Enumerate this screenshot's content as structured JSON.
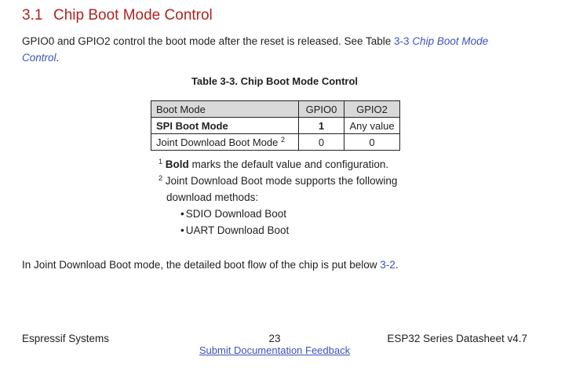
{
  "section": {
    "number": "3.1",
    "title": "Chip Boot Mode Control"
  },
  "intro": {
    "text": "GPIO0 and GPIO2 control the boot mode after the reset is released. See Table ",
    "table_ref": "3-3",
    "table_title_ref": "Chip Boot Mode Control",
    "end": "."
  },
  "table": {
    "caption": "Table 3-3. Chip Boot Mode Control",
    "headers": [
      "Boot Mode",
      "GPIO0",
      "GPIO2"
    ],
    "rows": [
      {
        "mode": "SPI Boot Mode",
        "gpio0": "1",
        "gpio2": "Any value"
      },
      {
        "mode": "Joint Download Boot Mode",
        "mode_note": "2",
        "gpio0": "0",
        "gpio2": "0"
      }
    ]
  },
  "notes": {
    "note1": {
      "marker": "1",
      "bold": "Bold",
      "text": " marks the default value and configuration."
    },
    "note2": {
      "marker": "2",
      "text": " Joint Download Boot mode supports the following download methods:"
    },
    "methods": [
      "SDIO Download Boot",
      "UART Download Boot"
    ]
  },
  "boot_flow": {
    "text": "In Joint Download Boot mode, the detailed boot flow of the chip is put below ",
    "ref": "3-2",
    "end": "."
  },
  "footer": {
    "company": "Espressif Systems",
    "page": "23",
    "feedback": "Submit Documentation Feedback",
    "doc": "ESP32 Series Datasheet v4.7"
  },
  "colors": {
    "heading": "#b0241f",
    "link": "#3c52b8",
    "table_header_bg": "#d9d9d9"
  }
}
